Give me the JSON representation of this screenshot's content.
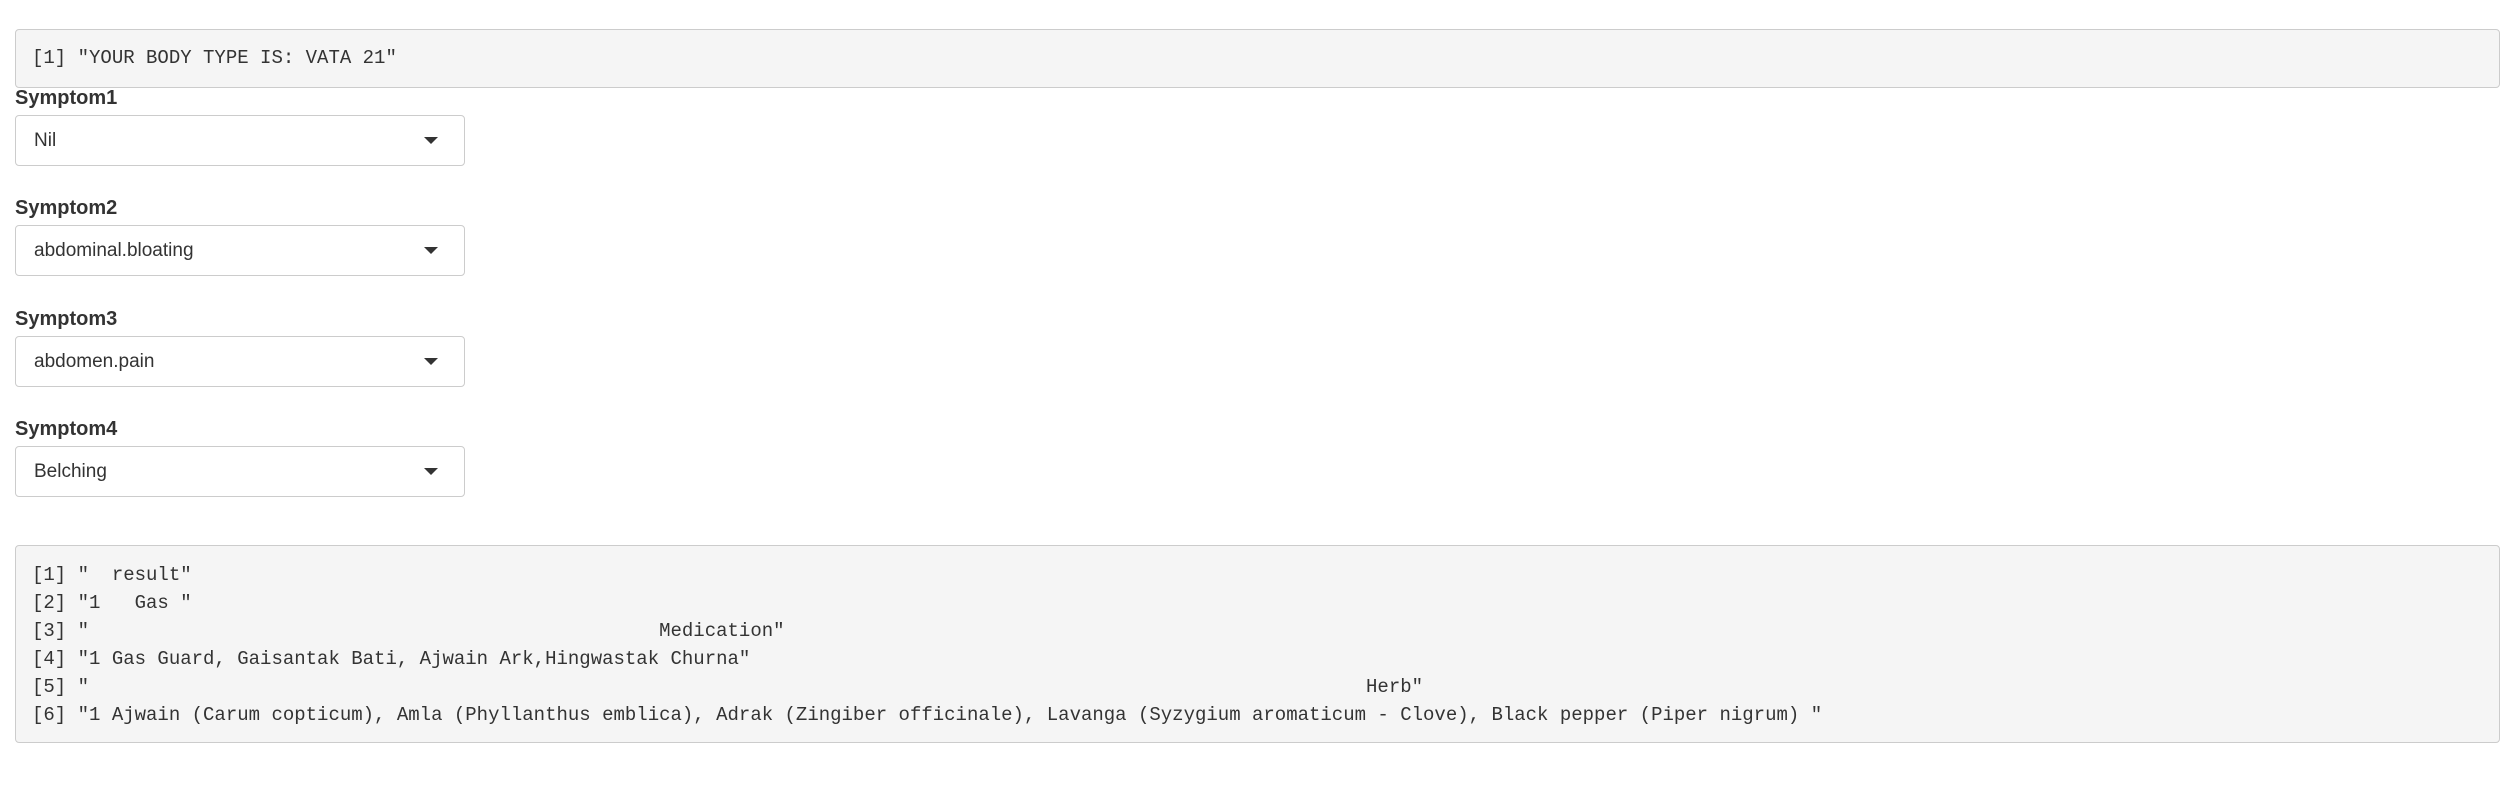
{
  "body_type_output": "[1] \"YOUR BODY TYPE IS: VATA 21\"",
  "symptoms": [
    {
      "label": "Symptom1",
      "value": "Nil"
    },
    {
      "label": "Symptom2",
      "value": "abdominal.bloating"
    },
    {
      "label": "Symptom3",
      "value": "abdomen.pain"
    },
    {
      "label": "Symptom4",
      "value": "Belching"
    }
  ],
  "icons": {
    "dropdown": "caret-down-icon"
  },
  "result_output": [
    "[1] \"  result\"",
    "[2] \"1   Gas \"",
    "[3] \"                                                  Medication\"",
    "[4] \"1 Gas Guard, Gaisantak Bati, Ajwain Ark,Hingwastak Churna\"",
    "[5] \"                                                                                                                Herb\"",
    "[6] \"1 Ajwain (Carum copticum), Amla (Phyllanthus emblica), Adrak (Zingiber officinale), Lavanga (Syzygium aromaticum - Clove), Black pepper (Piper nigrum) \""
  ]
}
